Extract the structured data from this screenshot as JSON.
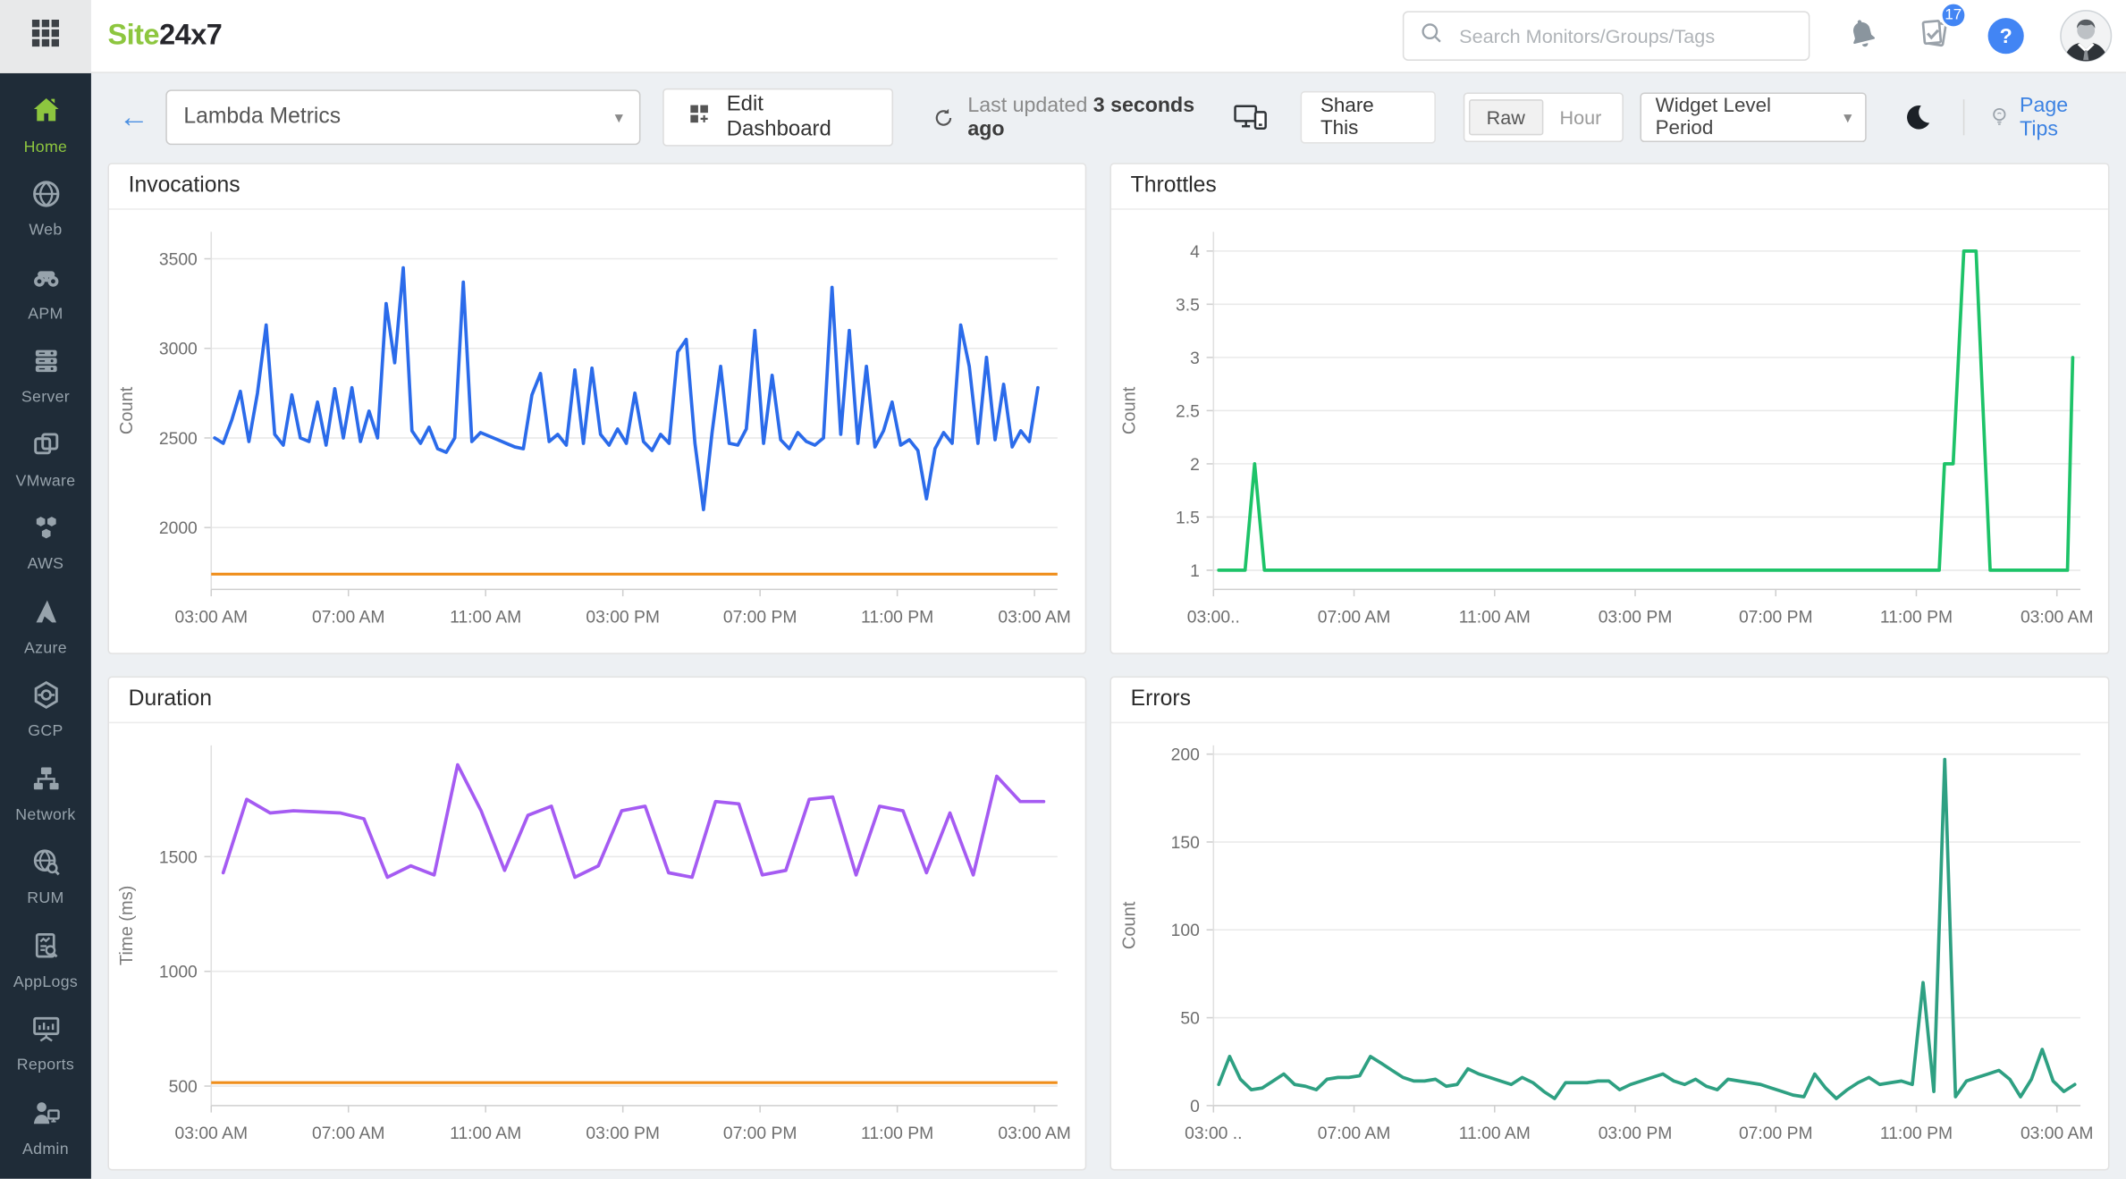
{
  "header": {
    "logo_green": "Site",
    "logo_dark": "24x7",
    "search_placeholder": "Search Monitors/Groups/Tags",
    "notifications_badge": "17",
    "help_label": "?"
  },
  "toolbar": {
    "back_arrow": "←",
    "dashboard_name": "Lambda Metrics",
    "edit_dashboard_label": "Edit Dashboard",
    "last_updated_prefix": "Last updated",
    "last_updated_value": "3 seconds ago",
    "share_this_label": "Share This",
    "granularity": {
      "raw": "Raw",
      "hour": "Hour",
      "selected": "Raw"
    },
    "period_selector_label": "Widget Level Period",
    "page_tips_label": "Page Tips"
  },
  "sidebar": {
    "items": [
      {
        "label": "Home",
        "icon": "home-icon",
        "active": true
      },
      {
        "label": "Web",
        "icon": "web-icon",
        "active": false
      },
      {
        "label": "APM",
        "icon": "apm-icon",
        "active": false
      },
      {
        "label": "Server",
        "icon": "server-icon",
        "active": false
      },
      {
        "label": "VMware",
        "icon": "vmware-icon",
        "active": false
      },
      {
        "label": "AWS",
        "icon": "aws-icon",
        "active": false
      },
      {
        "label": "Azure",
        "icon": "azure-icon",
        "active": false
      },
      {
        "label": "GCP",
        "icon": "gcp-icon",
        "active": false
      },
      {
        "label": "Network",
        "icon": "network-icon",
        "active": false
      },
      {
        "label": "RUM",
        "icon": "rum-icon",
        "active": false
      },
      {
        "label": "AppLogs",
        "icon": "applogs-icon",
        "active": false
      },
      {
        "label": "Reports",
        "icon": "reports-icon",
        "active": false
      },
      {
        "label": "Admin",
        "icon": "admin-icon",
        "active": false
      }
    ]
  },
  "colors": {
    "brand_green": "#8dc63f",
    "link_blue": "#3c82e2",
    "badge_blue": "#4285f4",
    "sidebar_bg": "#1f2c38",
    "sidebar_inactive": "#97a3ac",
    "page_bg": "#edf0f3",
    "threshold_orange": "#ef8e1b",
    "invocations_line": "#2b6bea",
    "throttles_line": "#1dc368",
    "duration_line": "#a55bf2",
    "errors_line": "#2ea082"
  },
  "chart_data": [
    {
      "id": "invocations",
      "type": "line",
      "title": "Invocations",
      "color": "#2b6bea",
      "ylabel": "Count",
      "ylim": [
        1655,
        3650
      ],
      "yticks": [
        2000,
        2500,
        3000,
        3500
      ],
      "x_span_hours": 24.67,
      "xticks": [
        {
          "t": 0,
          "label": "03:00 AM"
        },
        {
          "t": 4,
          "label": "07:00 AM"
        },
        {
          "t": 8,
          "label": "11:00 AM"
        },
        {
          "t": 12,
          "label": "03:00 PM"
        },
        {
          "t": 16,
          "label": "07:00 PM"
        },
        {
          "t": 20,
          "label": "11:00 PM"
        },
        {
          "t": 24,
          "label": "03:00 AM"
        }
      ],
      "threshold": {
        "value": 1740,
        "color": "#ef8e1b"
      },
      "series": {
        "t0": 0.1,
        "step_min": 15,
        "values": [
          2500,
          2470,
          2600,
          2760,
          2480,
          2750,
          3130,
          2520,
          2460,
          2740,
          2500,
          2480,
          2700,
          2460,
          2775,
          2500,
          2780,
          2480,
          2650,
          2500,
          3250,
          2920,
          3450,
          2540,
          2470,
          2560,
          2440,
          2420,
          2500,
          3370,
          2480,
          2530,
          2510,
          2490,
          2470,
          2450,
          2440,
          2740,
          2860,
          2480,
          2520,
          2460,
          2880,
          2470,
          2890,
          2520,
          2460,
          2550,
          2470,
          2750,
          2480,
          2430,
          2520,
          2470,
          2980,
          3050,
          2470,
          2100,
          2530,
          2900,
          2470,
          2460,
          2550,
          3100,
          2470,
          2850,
          2490,
          2440,
          2530,
          2480,
          2460,
          2500,
          3340,
          2520,
          3100,
          2470,
          2900,
          2450,
          2540,
          2700,
          2460,
          2490,
          2430,
          2160,
          2440,
          2530,
          2470,
          3130,
          2900,
          2470,
          2950,
          2490,
          2800,
          2450,
          2540,
          2480,
          2780
        ]
      }
    },
    {
      "id": "throttles",
      "type": "line",
      "title": "Throttles",
      "color": "#1dc368",
      "ylabel": "Count",
      "ylim": [
        0.82,
        4.18
      ],
      "yticks": [
        1,
        1.5,
        2,
        2.5,
        3,
        3.5,
        4
      ],
      "x_span_hours": 24.67,
      "xticks": [
        {
          "t": 0,
          "label": "03:00.."
        },
        {
          "t": 4,
          "label": "07:00 AM"
        },
        {
          "t": 8,
          "label": "11:00 AM"
        },
        {
          "t": 12,
          "label": "03:00 PM"
        },
        {
          "t": 16,
          "label": "07:00 PM"
        },
        {
          "t": 20,
          "label": "11:00 PM"
        },
        {
          "t": 24,
          "label": "03:00 AM"
        }
      ],
      "series": {
        "points": [
          [
            0.15,
            1
          ],
          [
            0.9,
            1
          ],
          [
            1.17,
            2
          ],
          [
            1.45,
            1
          ],
          [
            3,
            1
          ],
          [
            6,
            1
          ],
          [
            9,
            1
          ],
          [
            12,
            1
          ],
          [
            15,
            1
          ],
          [
            18,
            1
          ],
          [
            20.5,
            1
          ],
          [
            20.65,
            1
          ],
          [
            20.8,
            2
          ],
          [
            21.05,
            2
          ],
          [
            21.35,
            4
          ],
          [
            21.7,
            4
          ],
          [
            22.1,
            1
          ],
          [
            23,
            1
          ],
          [
            24.3,
            1
          ],
          [
            24.45,
            3
          ]
        ]
      }
    },
    {
      "id": "duration",
      "type": "line",
      "title": "Duration",
      "color": "#a55bf2",
      "ylabel": "Time (ms)",
      "ylim": [
        415,
        1985
      ],
      "yticks": [
        500,
        1000,
        1500
      ],
      "x_span_hours": 24.67,
      "xticks": [
        {
          "t": 0,
          "label": "03:00 AM"
        },
        {
          "t": 4,
          "label": "07:00 AM"
        },
        {
          "t": 8,
          "label": "11:00 AM"
        },
        {
          "t": 12,
          "label": "03:00 PM"
        },
        {
          "t": 16,
          "label": "07:00 PM"
        },
        {
          "t": 20,
          "label": "11:00 PM"
        },
        {
          "t": 24,
          "label": "03:00 AM"
        }
      ],
      "threshold": {
        "value": 515,
        "color": "#ef8e1b"
      },
      "series": {
        "t0": 0.35,
        "step_min": 41,
        "values": [
          1430,
          1750,
          1690,
          1700,
          1695,
          1690,
          1665,
          1410,
          1460,
          1420,
          1900,
          1700,
          1440,
          1680,
          1720,
          1410,
          1460,
          1700,
          1720,
          1430,
          1410,
          1740,
          1730,
          1420,
          1440,
          1750,
          1760,
          1420,
          1720,
          1700,
          1430,
          1690,
          1420,
          1850,
          1740,
          1740
        ]
      }
    },
    {
      "id": "errors",
      "type": "line",
      "title": "Errors",
      "color": "#2ea082",
      "ylabel": "Count",
      "ylim": [
        0,
        205
      ],
      "yticks": [
        0,
        50,
        100,
        150,
        200
      ],
      "x_span_hours": 24.67,
      "xticks": [
        {
          "t": 0,
          "label": "03:00 .."
        },
        {
          "t": 4,
          "label": "07:00 AM"
        },
        {
          "t": 8,
          "label": "11:00 AM"
        },
        {
          "t": 12,
          "label": "03:00 PM"
        },
        {
          "t": 16,
          "label": "07:00 PM"
        },
        {
          "t": 20,
          "label": "11:00 PM"
        },
        {
          "t": 24,
          "label": "03:00 AM"
        }
      ],
      "series": {
        "t0": 0.15,
        "step_min": 18.5,
        "values": [
          12,
          28,
          15,
          9,
          10,
          14,
          18,
          12,
          11,
          9,
          15,
          16,
          16,
          17,
          28,
          24,
          20,
          16,
          14,
          14,
          15,
          11,
          12,
          21,
          18,
          16,
          14,
          12,
          16,
          13,
          8,
          4,
          13,
          13,
          13,
          14,
          14,
          9,
          12,
          14,
          16,
          18,
          14,
          12,
          15,
          11,
          9,
          15,
          14,
          13,
          12,
          10,
          8,
          6,
          5,
          18,
          10,
          4,
          9,
          13,
          16,
          12,
          13,
          14,
          12,
          70,
          8,
          197,
          5,
          14,
          16,
          18,
          20,
          15,
          5,
          15,
          32,
          14,
          8,
          12
        ]
      }
    }
  ]
}
